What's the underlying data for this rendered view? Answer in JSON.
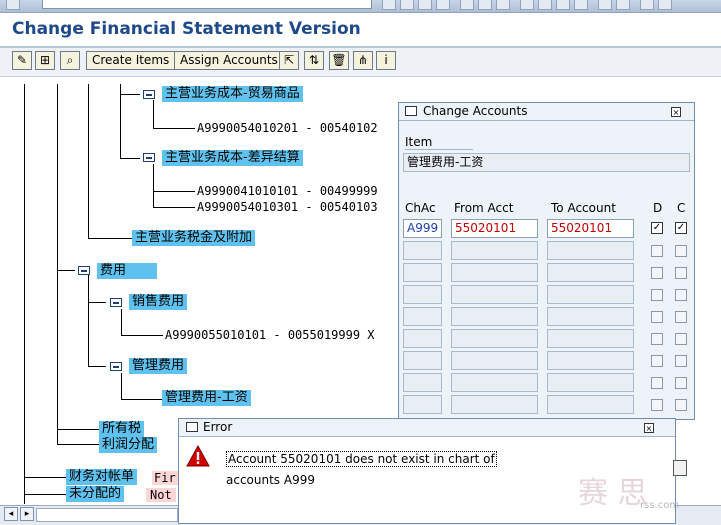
{
  "window": {
    "title": "Change Financial Statement Version"
  },
  "toolbar": {
    "create_items_label": "Create Items",
    "assign_accounts_label": "Assign Accounts"
  },
  "tree": {
    "node_cogs_trade": "主营业务成本-贸易商品",
    "node_cogs_trade_range": "A9990054010201 - 00540102",
    "node_cogs_diff": "主营业务成本-差异结算",
    "node_cogs_diff_range1": "A9990041010101 - 00499999",
    "node_cogs_diff_range2": "A9990054010301 - 00540103",
    "node_tax_surcharge": "主营业务税金及附加",
    "node_expenses": "费用",
    "node_selling_exp": "销售费用",
    "node_selling_range": "A9990055010101 - 0055019999 X",
    "node_admin_exp": "管理费用",
    "node_admin_salary": "管理费用-工资",
    "node_income_tax": "所有税",
    "node_profit_dist": "利润分配",
    "node_reconcile": "财务对帐单",
    "node_reconcile_tag": "Fir",
    "node_unassigned": "未分配的",
    "node_unassigned_tag": "Not"
  },
  "change_accounts_dialog": {
    "title": "Change Accounts",
    "item_label": "Item",
    "item_value": "管理费用-工资",
    "col_chac": "ChAc",
    "col_from": "From Acct",
    "col_to": "To Account",
    "col_d": "D",
    "col_c": "C",
    "row1": {
      "chac": "A999",
      "from": "55020101",
      "to": "55020101",
      "d_checked": true,
      "c_checked": true
    },
    "empty_rows": 9
  },
  "error_dialog": {
    "title": "Error",
    "message_line1": "Account 55020101 does not exist in chart of",
    "message_line2": "accounts A999"
  },
  "watermark": {
    "text": "赛 思",
    "site": "rss.com"
  }
}
